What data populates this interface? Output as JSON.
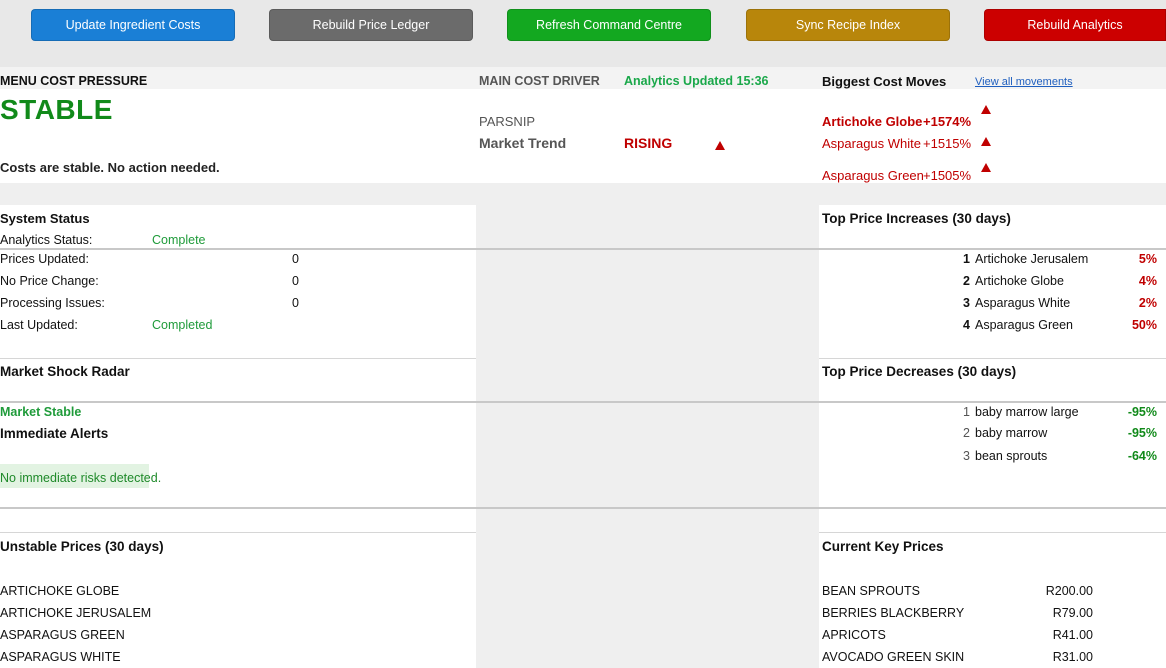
{
  "toolbar": {
    "buttons": [
      {
        "label": "Update Ingredient Costs",
        "color": "#1a7fd6"
      },
      {
        "label": "Rebuild Price Ledger",
        "color": "#6b6b6b"
      },
      {
        "label": "Refresh Command Centre",
        "color": "#13a820"
      },
      {
        "label": "Sync Recipe Index",
        "color": "#b8860b"
      },
      {
        "label": "Rebuild Analytics",
        "color": "#cc0000"
      }
    ]
  },
  "pressure": {
    "heading": "MENU COST PRESSURE",
    "status": "STABLE",
    "message": "Costs are stable. No action needed."
  },
  "driver": {
    "heading": "MAIN COST DRIVER",
    "analytics_updated": "Analytics Updated 15:36",
    "ingredient": "PARSNIP",
    "trend_label": "Market Trend",
    "trend_value": "RISING"
  },
  "moves": {
    "heading": "Biggest Cost Moves",
    "link": "View all movements",
    "items": [
      {
        "name": "Artichoke Globe",
        "pct": "+1574%"
      },
      {
        "name": "Asparagus White",
        "pct": "+1515%"
      },
      {
        "name": "Asparagus Green",
        "pct": "+1505%"
      }
    ]
  },
  "system": {
    "heading": "System Status",
    "analytics_label": "Analytics Status:",
    "analytics_value": "Complete",
    "rows": [
      {
        "label": "Prices Updated:",
        "value": "0"
      },
      {
        "label": "No Price Change:",
        "value": "0"
      },
      {
        "label": "Processing Issues:",
        "value": "0"
      }
    ],
    "last_label": "Last Updated:",
    "last_value": "Completed"
  },
  "increases": {
    "heading": "Top Price Increases (30 days)",
    "items": [
      {
        "rank": "1",
        "name": "Artichoke Jerusalem",
        "pct": "5%"
      },
      {
        "rank": "2",
        "name": "Artichoke Globe",
        "pct": "4%"
      },
      {
        "rank": "3",
        "name": "Asparagus White",
        "pct": "2%"
      },
      {
        "rank": "4",
        "name": "Asparagus Green",
        "pct": "50%"
      }
    ]
  },
  "shock": {
    "heading": "Market Shock Radar",
    "status": "Market Stable",
    "alerts_heading": "Immediate Alerts",
    "alerts_message": "No immediate risks detected."
  },
  "decreases": {
    "heading": "Top Price Decreases (30 days)",
    "items": [
      {
        "rank": "1",
        "name": "baby marrow large",
        "pct": "-95%"
      },
      {
        "rank": "2",
        "name": "baby marrow",
        "pct": "-95%"
      },
      {
        "rank": "3",
        "name": "bean sprouts",
        "pct": "-64%"
      }
    ]
  },
  "unstable": {
    "heading": "Unstable Prices (30 days)",
    "items": [
      "ARTICHOKE GLOBE",
      "ARTICHOKE JERUSALEM",
      "ASPARAGUS GREEN",
      "ASPARAGUS WHITE"
    ]
  },
  "key_prices": {
    "heading": "Current Key Prices",
    "items": [
      {
        "name": "BEAN SPROUTS",
        "price": "R200.00"
      },
      {
        "name": "BERRIES BLACKBERRY",
        "price": "R79.00"
      },
      {
        "name": "APRICOTS",
        "price": "R41.00"
      },
      {
        "name": "AVOCADO GREEN SKIN",
        "price": "R31.00"
      }
    ]
  }
}
